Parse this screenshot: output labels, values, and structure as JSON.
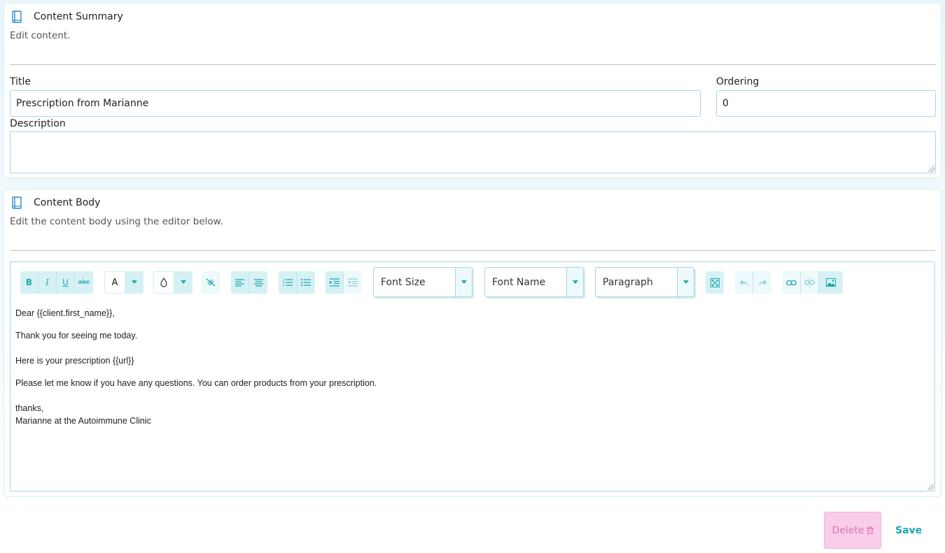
{
  "summary": {
    "title": "Content Summary",
    "subtitle": "Edit content.",
    "title_label": "Title",
    "title_value": "Prescription from Marianne",
    "ordering_label": "Ordering",
    "ordering_value": "0",
    "description_label": "Description",
    "description_value": ""
  },
  "body": {
    "title": "Content Body",
    "subtitle": "Edit the content body using the editor below."
  },
  "toolbar": {
    "bold": "B",
    "italic": "I",
    "underline": "U",
    "strike": "abc",
    "font_color": "A",
    "font_size_select": "Font Size",
    "font_name_select": "Font Name",
    "format_select": "Paragraph"
  },
  "editor": {
    "lines": [
      "Dear {{client.first_name}},",
      "Thank you for seeing me today.",
      "Here is your prescription {{url}}",
      "Please let me know if you have any questions. You can order products from your prescription.",
      "thanks,",
      "Marianne at the Autoimmune Clinic"
    ]
  },
  "actions": {
    "delete_label": "Delete",
    "save_label": "Save"
  },
  "colors": {
    "accent": "#18a8b0",
    "delete_bg": "#f9cde9",
    "input_border": "#a9d6e3"
  }
}
